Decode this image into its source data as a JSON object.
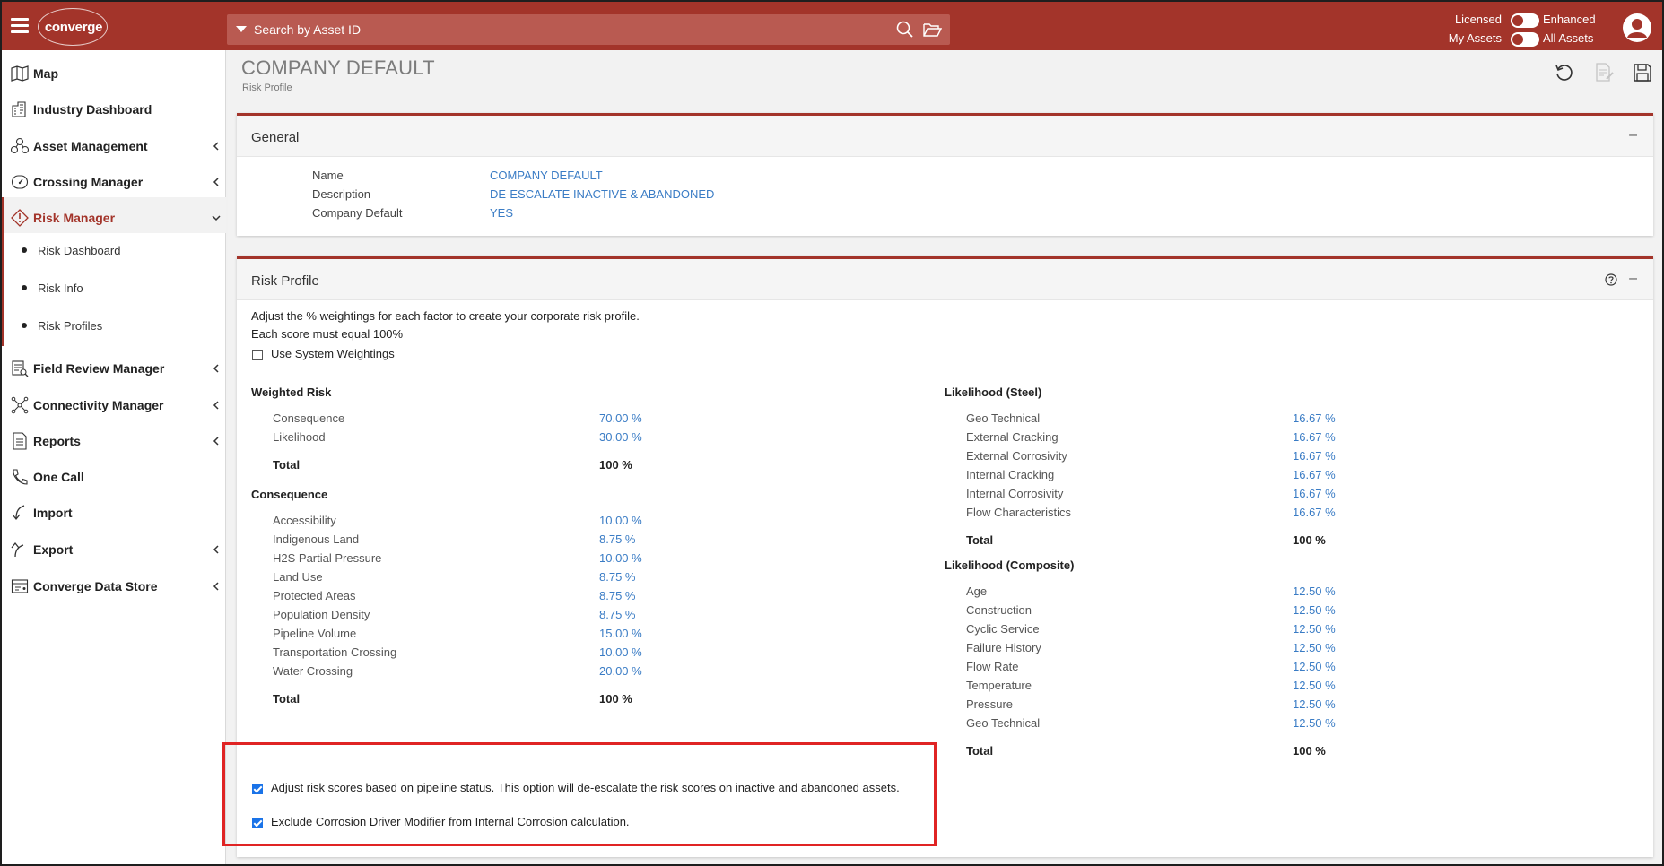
{
  "header": {
    "logo_text": "converge",
    "search_placeholder": "Search by Asset ID",
    "toggle1_left": "Licensed",
    "toggle1_right": "Enhanced",
    "toggle2_left": "My Assets",
    "toggle2_right": "All Assets",
    "accent_color": "#a3342a"
  },
  "sidebar": {
    "items": [
      {
        "label": "Map",
        "icon": "map-icon"
      },
      {
        "label": "Industry Dashboard",
        "icon": "building-icon"
      },
      {
        "label": "Asset Management",
        "icon": "asset-icon"
      },
      {
        "label": "Crossing Manager",
        "icon": "gauge-icon"
      },
      {
        "label": "Risk Manager",
        "icon": "warning-icon"
      },
      {
        "label": "Field Review Manager",
        "icon": "review-icon"
      },
      {
        "label": "Connectivity Manager",
        "icon": "network-icon"
      },
      {
        "label": "Reports",
        "icon": "report-icon"
      },
      {
        "label": "One Call",
        "icon": "phone-icon"
      },
      {
        "label": "Import",
        "icon": "import-icon"
      },
      {
        "label": "Export",
        "icon": "export-icon"
      },
      {
        "label": "Converge Data Store",
        "icon": "datastore-icon"
      }
    ],
    "risk_sub": [
      "Risk Dashboard",
      "Risk Info",
      "Risk Profiles"
    ]
  },
  "page": {
    "title": "COMPANY DEFAULT",
    "subtitle": "Risk Profile"
  },
  "general": {
    "title": "General",
    "collapse": "–",
    "fields": [
      {
        "label": "Name",
        "value": "COMPANY DEFAULT"
      },
      {
        "label": "Description",
        "value": "DE-ESCALATE INACTIVE & ABANDONED"
      },
      {
        "label": "Company Default",
        "value": "YES"
      }
    ]
  },
  "risk_profile": {
    "title": "Risk Profile",
    "collapse": "–",
    "intro1": "Adjust the % weightings for each factor to create your corporate risk profile.",
    "intro2": "Each score must equal 100%",
    "use_system": "Use System Weightings",
    "weighted_risk": {
      "title": "Weighted Risk",
      "rows": [
        {
          "label": "Consequence",
          "value": "70.00 %"
        },
        {
          "label": "Likelihood",
          "value": "30.00 %"
        }
      ],
      "total_label": "Total",
      "total_value": "100 %"
    },
    "consequence": {
      "title": "Consequence",
      "rows": [
        {
          "label": "Accessibility",
          "value": "10.00 %"
        },
        {
          "label": "Indigenous Land",
          "value": "8.75 %"
        },
        {
          "label": "H2S Partial Pressure",
          "value": "10.00 %"
        },
        {
          "label": "Land Use",
          "value": "8.75 %"
        },
        {
          "label": "Protected Areas",
          "value": "8.75 %"
        },
        {
          "label": "Population Density",
          "value": "8.75 %"
        },
        {
          "label": "Pipeline Volume",
          "value": "15.00 %"
        },
        {
          "label": "Transportation Crossing",
          "value": "10.00 %"
        },
        {
          "label": "Water Crossing",
          "value": "20.00 %"
        }
      ],
      "total_label": "Total",
      "total_value": "100 %"
    },
    "likelihood_steel": {
      "title": "Likelihood (Steel)",
      "rows": [
        {
          "label": "Geo Technical",
          "value": "16.67 %"
        },
        {
          "label": "External Cracking",
          "value": "16.67 %"
        },
        {
          "label": "External Corrosivity",
          "value": "16.67 %"
        },
        {
          "label": "Internal Cracking",
          "value": "16.67 %"
        },
        {
          "label": "Internal Corrosivity",
          "value": "16.67 %"
        },
        {
          "label": "Flow Characteristics",
          "value": "16.67 %"
        }
      ],
      "total_label": "Total",
      "total_value": "100 %"
    },
    "likelihood_composite": {
      "title": "Likelihood (Composite)",
      "rows": [
        {
          "label": "Age",
          "value": "12.50 %"
        },
        {
          "label": "Construction",
          "value": "12.50 %"
        },
        {
          "label": "Cyclic Service",
          "value": "12.50 %"
        },
        {
          "label": "Failure History",
          "value": "12.50 %"
        },
        {
          "label": "Flow Rate",
          "value": "12.50 %"
        },
        {
          "label": "Temperature",
          "value": "12.50 %"
        },
        {
          "label": "Pressure",
          "value": "12.50 %"
        },
        {
          "label": "Geo Technical",
          "value": "12.50 %"
        }
      ],
      "total_label": "Total",
      "total_value": "100 %"
    },
    "option1": "Adjust risk scores based on pipeline status. This option will de-escalate the risk scores on inactive and abandoned assets.",
    "option2": "Exclude Corrosion Driver Modifier from Internal Corrosion calculation."
  }
}
